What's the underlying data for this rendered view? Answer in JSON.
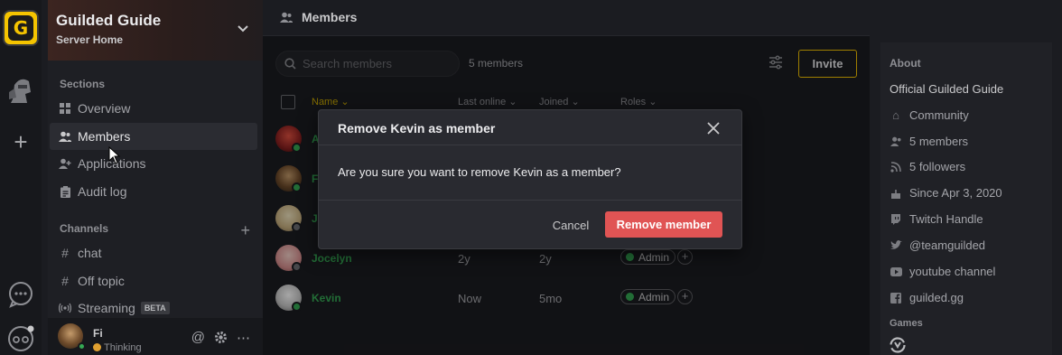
{
  "server": {
    "name": "Guilded Guide",
    "subtitle": "Server Home",
    "logo_letter": "G"
  },
  "sidebar": {
    "sections_label": "Sections",
    "sections": [
      {
        "label": "Overview",
        "icon": "grid-icon"
      },
      {
        "label": "Members",
        "icon": "members-icon",
        "active": true
      },
      {
        "label": "Applications",
        "icon": "user-add-icon"
      },
      {
        "label": "Audit log",
        "icon": "clipboard-icon"
      }
    ],
    "channels_label": "Channels",
    "channels": [
      {
        "label": "chat",
        "icon": "hash-icon"
      },
      {
        "label": "Off topic",
        "icon": "hash-icon"
      },
      {
        "label": "Streaming",
        "icon": "broadcast-icon",
        "badge": "BETA"
      }
    ]
  },
  "user": {
    "name": "Fi",
    "status": "Thinking"
  },
  "main": {
    "title": "Members",
    "search_placeholder": "Search members",
    "member_count": "5 members",
    "invite_label": "Invite",
    "columns": {
      "name": "Name",
      "last_online": "Last online",
      "joined": "Joined",
      "roles": "Roles"
    },
    "rows": [
      {
        "name": "A",
        "last_online": "",
        "joined": "",
        "status": "online",
        "avatar_color": "#b8322a"
      },
      {
        "name": "F",
        "last_online": "",
        "joined": "",
        "status": "online",
        "avatar_color": "#6d4a2a"
      },
      {
        "name": "J",
        "last_online": "",
        "joined": "",
        "status": "offline",
        "avatar_color": "#d7c9a0"
      },
      {
        "name": "Jocelyn",
        "last_online": "2y",
        "joined": "2y",
        "status": "offline",
        "role": "Admin",
        "avatar_color": "#e8b0b0"
      },
      {
        "name": "Kevin",
        "last_online": "Now",
        "joined": "5mo",
        "status": "online",
        "role": "Admin",
        "avatar_color": "#d8d8d8"
      }
    ]
  },
  "about": {
    "title": "About",
    "description": "Official Guilded Guide",
    "items": [
      {
        "label": "Community",
        "icon": "building-icon"
      },
      {
        "label": "5 members",
        "icon": "members-icon"
      },
      {
        "label": "5 followers",
        "icon": "rss-icon"
      },
      {
        "label": "Since Apr 3, 2020",
        "icon": "cake-icon"
      },
      {
        "label": "Twitch Handle",
        "icon": "twitch-icon"
      },
      {
        "label": "@teamguilded",
        "icon": "twitter-icon"
      },
      {
        "label": "youtube channel",
        "icon": "youtube-icon"
      },
      {
        "label": "guilded.gg",
        "icon": "facebook-icon"
      }
    ],
    "games_label": "Games"
  },
  "modal": {
    "title": "Remove Kevin as member",
    "body": "Are you sure you want to remove Kevin as a member?",
    "cancel_label": "Cancel",
    "confirm_label": "Remove member",
    "confirm_color": "#e05454"
  },
  "colors": {
    "accent": "#f5c400",
    "online": "#35a853",
    "danger": "#e05454"
  }
}
